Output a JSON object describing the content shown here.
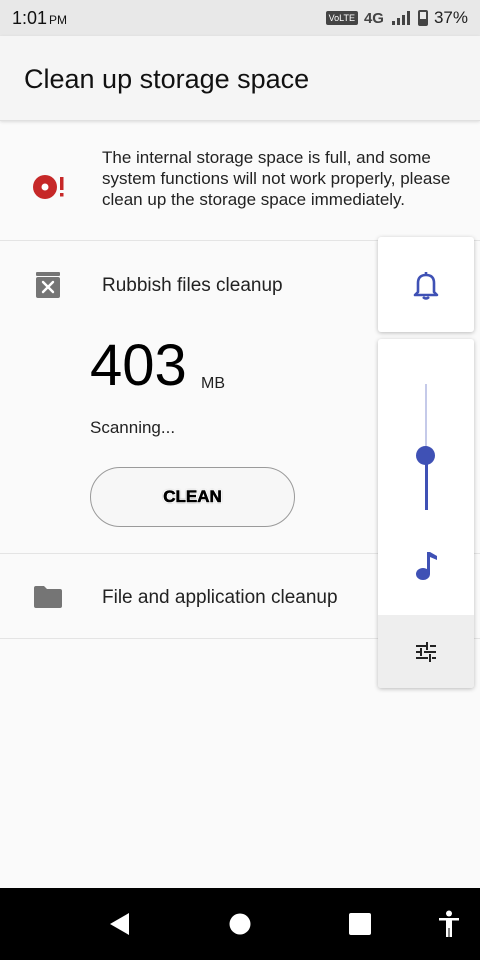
{
  "status_bar": {
    "time": "1:01",
    "ampm": "PM",
    "volte": "VoLTE",
    "network": "4G",
    "battery": "37%"
  },
  "header": {
    "title": "Clean up storage space"
  },
  "warning": {
    "text": "The internal storage space is full, and some system functions will not work properly, please clean up the storage space immediately.",
    "icon": "storage-warning-icon",
    "icon_color": "#c62828"
  },
  "rubbish": {
    "title": "Rubbish files cleanup",
    "size_value": "403",
    "size_unit": "MB",
    "status": "Scanning...",
    "clean_label": "CLEAN",
    "icon": "trash-icon"
  },
  "file_app": {
    "title": "File and application cleanup",
    "icon": "folder-icon"
  },
  "volume_panel": {
    "ringer_icon": "bell-icon",
    "media_icon": "music-note-icon",
    "settings_icon": "equalizer-settings-icon",
    "level": 0.43,
    "accent": "#3f51b5"
  },
  "nav_bar": {
    "back_icon": "back-triangle-icon",
    "home_icon": "home-circle-icon",
    "recents_icon": "recents-square-icon",
    "accessibility_icon": "accessibility-icon"
  }
}
